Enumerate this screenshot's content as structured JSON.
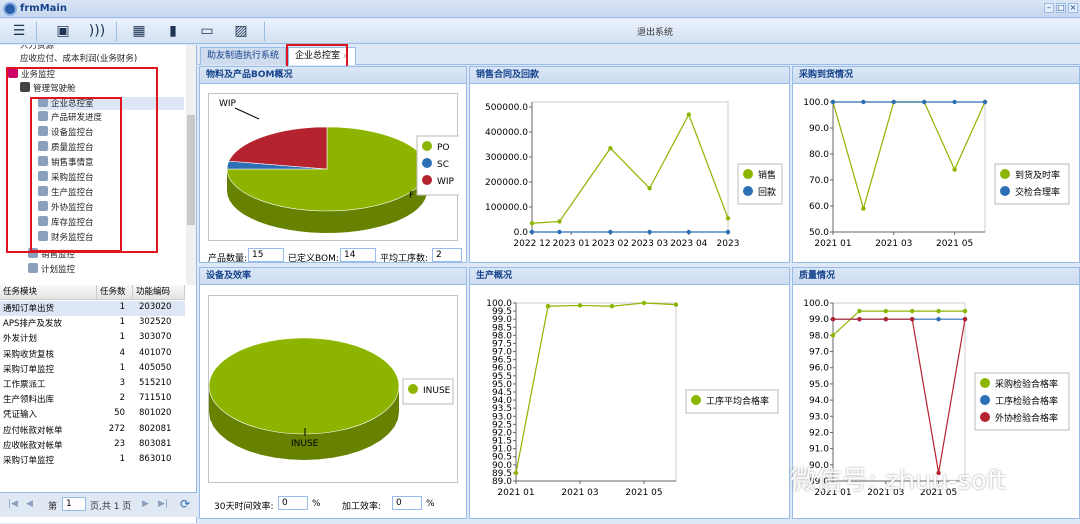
{
  "app": {
    "title": "frmMain",
    "exit_label": "退出系统"
  },
  "window_buttons": [
    "–",
    "□",
    "×"
  ],
  "toolbar_icons": [
    "menu-icon",
    "print-icon",
    "rss-icon",
    "calendar-icon",
    "bookmark-icon",
    "inbox-icon",
    "image-icon"
  ],
  "tree": {
    "items": [
      {
        "label": "人力资源",
        "indent": 1
      },
      {
        "label": "应收应付、成本利润(业务财务)",
        "indent": 1
      },
      {
        "label": "业务监控",
        "indent": 0
      },
      {
        "label": "管理驾驶舱",
        "indent": 1
      },
      {
        "label": "企业总控室",
        "indent": 2
      },
      {
        "label": "产品研发进度",
        "indent": 2
      },
      {
        "label": "设备监控台",
        "indent": 2
      },
      {
        "label": "质量监控台",
        "indent": 2
      },
      {
        "label": "销售事情意",
        "indent": 2
      },
      {
        "label": "采购监控台",
        "indent": 2
      },
      {
        "label": "生产监控台",
        "indent": 2
      },
      {
        "label": "外协监控台",
        "indent": 2
      },
      {
        "label": "库存监控台",
        "indent": 2
      },
      {
        "label": "财务监控台",
        "indent": 2
      },
      {
        "label": "销售监控",
        "indent": 1
      },
      {
        "label": "计划监控",
        "indent": 1
      }
    ]
  },
  "grid": {
    "headers": [
      "任务模块",
      "任务数",
      "功能编码"
    ],
    "rows": [
      [
        "通知订单出货",
        "1",
        "203020"
      ],
      [
        "APS排产及发放",
        "1",
        "302520"
      ],
      [
        "外发计划",
        "1",
        "303070"
      ],
      [
        "采购收货复核",
        "4",
        "401070"
      ],
      [
        "采购订单监控",
        "1",
        "405050"
      ],
      [
        "工作票派工",
        "3",
        "515210"
      ],
      [
        "生产领料出库",
        "2",
        "711510"
      ],
      [
        "凭证输入",
        "50",
        "801020"
      ],
      [
        "应付帐款对帐单",
        "272",
        "802081"
      ],
      [
        "应收帐款对帐单",
        "23",
        "803081"
      ],
      [
        "采购订单监控",
        "1",
        "863010"
      ]
    ]
  },
  "pager": {
    "page_label": "第",
    "page_value": "1",
    "total_label": "页,共 1 页"
  },
  "tabs": [
    {
      "label": "助友制造执行系统",
      "active": false
    },
    {
      "label": "企业总控室",
      "active": true
    }
  ],
  "panels": {
    "bom": {
      "title": "物料及产品BOM概况",
      "wip_label": "WIP",
      "f_label": "F",
      "fields": [
        {
          "label": "产品数量:",
          "value": "15"
        },
        {
          "label": "已定义BOM:",
          "value": "14"
        },
        {
          "label": "平均工序数:",
          "value": "2"
        }
      ]
    },
    "sales": {
      "title": "销售合同及回款"
    },
    "purchase": {
      "title": "采购到货情况"
    },
    "equipment": {
      "title": "设备及效率",
      "pie_label": "INUSE",
      "fields": [
        {
          "label": "30天时间效率:",
          "value": "0",
          "unit": "%"
        },
        {
          "label": "加工效率:",
          "value": "0",
          "unit": "%"
        }
      ]
    },
    "production": {
      "title": "生产概况"
    },
    "quality": {
      "title": "质量情况"
    }
  },
  "watermark": "微信号: zhuu-soft",
  "colors": {
    "green": "#8db500",
    "blue": "#2c6fb5",
    "red": "#b5232f",
    "header": "#15428b"
  },
  "chart_data": [
    {
      "type": "pie",
      "id": "bom",
      "series": [
        {
          "name": "PO",
          "value": 75,
          "color": "#8db500"
        },
        {
          "name": "SC",
          "value": 3,
          "color": "#2c6fb5"
        },
        {
          "name": "WIP",
          "value": 22,
          "color": "#b5232f"
        }
      ]
    },
    {
      "type": "line",
      "id": "sales",
      "categories": [
        "2022 12",
        "2023 01",
        "2023 02",
        "2023 03",
        "2023 04",
        "2023"
      ],
      "x": [
        0,
        1,
        2,
        3,
        4,
        5
      ],
      "series": [
        {
          "name": "销售",
          "x": [
            0,
            0.7,
            2,
            3,
            4,
            5
          ],
          "values": [
            35000,
            42000,
            335000,
            175000,
            470000,
            55000
          ],
          "color": "#8db500"
        },
        {
          "name": "回款",
          "x": [
            0,
            0.7,
            2,
            3,
            4,
            5
          ],
          "values": [
            0,
            0,
            0,
            0,
            0,
            0
          ],
          "color": "#2c6fb5"
        }
      ],
      "yticks": [
        0,
        100000,
        200000,
        300000,
        400000,
        500000
      ],
      "ytick_labels": [
        "0.0",
        "100000.0",
        "200000.0",
        "300000.0",
        "400000.0",
        "500000.0"
      ],
      "ylim": [
        0,
        520000
      ]
    },
    {
      "type": "line",
      "id": "purchase",
      "categories": [
        "2021 01",
        "2021 03",
        "2021 05"
      ],
      "x": [
        0,
        2,
        4
      ],
      "series": [
        {
          "name": "到货及时率",
          "x": [
            0,
            1,
            2,
            3,
            4,
            5
          ],
          "values": [
            100,
            59,
            100,
            100,
            74,
            100
          ],
          "color": "#8db500"
        },
        {
          "name": "交检合理率",
          "x": [
            0,
            1,
            2,
            3,
            4,
            5
          ],
          "values": [
            100,
            100,
            100,
            100,
            100,
            100
          ],
          "color": "#2c6fb5"
        }
      ],
      "yticks": [
        50,
        60,
        70,
        80,
        90,
        100
      ],
      "ytick_labels": [
        "50.0",
        "60.0",
        "70.0",
        "80.0",
        "90.0",
        "100.0"
      ],
      "ylim": [
        50,
        100
      ]
    },
    {
      "type": "pie",
      "id": "equipment",
      "series": [
        {
          "name": "INUSE",
          "value": 100,
          "color": "#8db500"
        }
      ]
    },
    {
      "type": "line",
      "id": "production",
      "categories": [
        "2021 01",
        "2021 03",
        "2021 05"
      ],
      "x": [
        0,
        2,
        4
      ],
      "series": [
        {
          "name": "工序平均合格率",
          "x": [
            0,
            1,
            2,
            3,
            4,
            5
          ],
          "values": [
            89.5,
            99.8,
            99.85,
            99.8,
            100,
            99.9
          ],
          "color": "#8db500"
        }
      ],
      "yticks": [
        89,
        89.5,
        90,
        90.5,
        91,
        91.5,
        92,
        92.5,
        93,
        93.5,
        94,
        94.5,
        95,
        95.5,
        96,
        96.5,
        97,
        97.5,
        98,
        98.5,
        99,
        99.5,
        100
      ],
      "ytick_labels": [
        "89.0",
        "89.5",
        "90.0",
        "90.5",
        "91.0",
        "91.5",
        "92.0",
        "92.5",
        "93.0",
        "93.5",
        "94.0",
        "94.5",
        "95.0",
        "95.5",
        "96.0",
        "96.5",
        "97.0",
        "97.5",
        "98.0",
        "98.5",
        "99.0",
        "99.5",
        "100.0"
      ],
      "ylim": [
        89,
        100
      ]
    },
    {
      "type": "line",
      "id": "quality",
      "categories": [
        "2021 01",
        "2021 03",
        "2021 05"
      ],
      "x": [
        0,
        2,
        4
      ],
      "series": [
        {
          "name": "采购检验合格率",
          "x": [
            0,
            1,
            2,
            3,
            4,
            5
          ],
          "values": [
            98,
            99.5,
            99.5,
            99.5,
            99.5,
            99.5
          ],
          "color": "#8db500"
        },
        {
          "name": "工序检验合格率",
          "x": [
            0,
            1,
            2,
            3,
            4,
            5
          ],
          "values": [
            99,
            99,
            99,
            99,
            99,
            99
          ],
          "color": "#2c6fb5"
        },
        {
          "name": "外协检验合格率",
          "x": [
            0,
            1,
            2,
            3,
            4,
            5
          ],
          "values": [
            99,
            99,
            99,
            99,
            89.5,
            99
          ],
          "color": "#b5232f"
        }
      ],
      "yticks": [
        89,
        90,
        91,
        92,
        93,
        94,
        95,
        96,
        97,
        98,
        99,
        100
      ],
      "ytick_labels": [
        "89.0",
        "90.0",
        "91.0",
        "92.0",
        "93.0",
        "94.0",
        "95.0",
        "96.0",
        "97.0",
        "98.0",
        "99.0",
        "100.0"
      ],
      "ylim": [
        89,
        100
      ]
    }
  ]
}
